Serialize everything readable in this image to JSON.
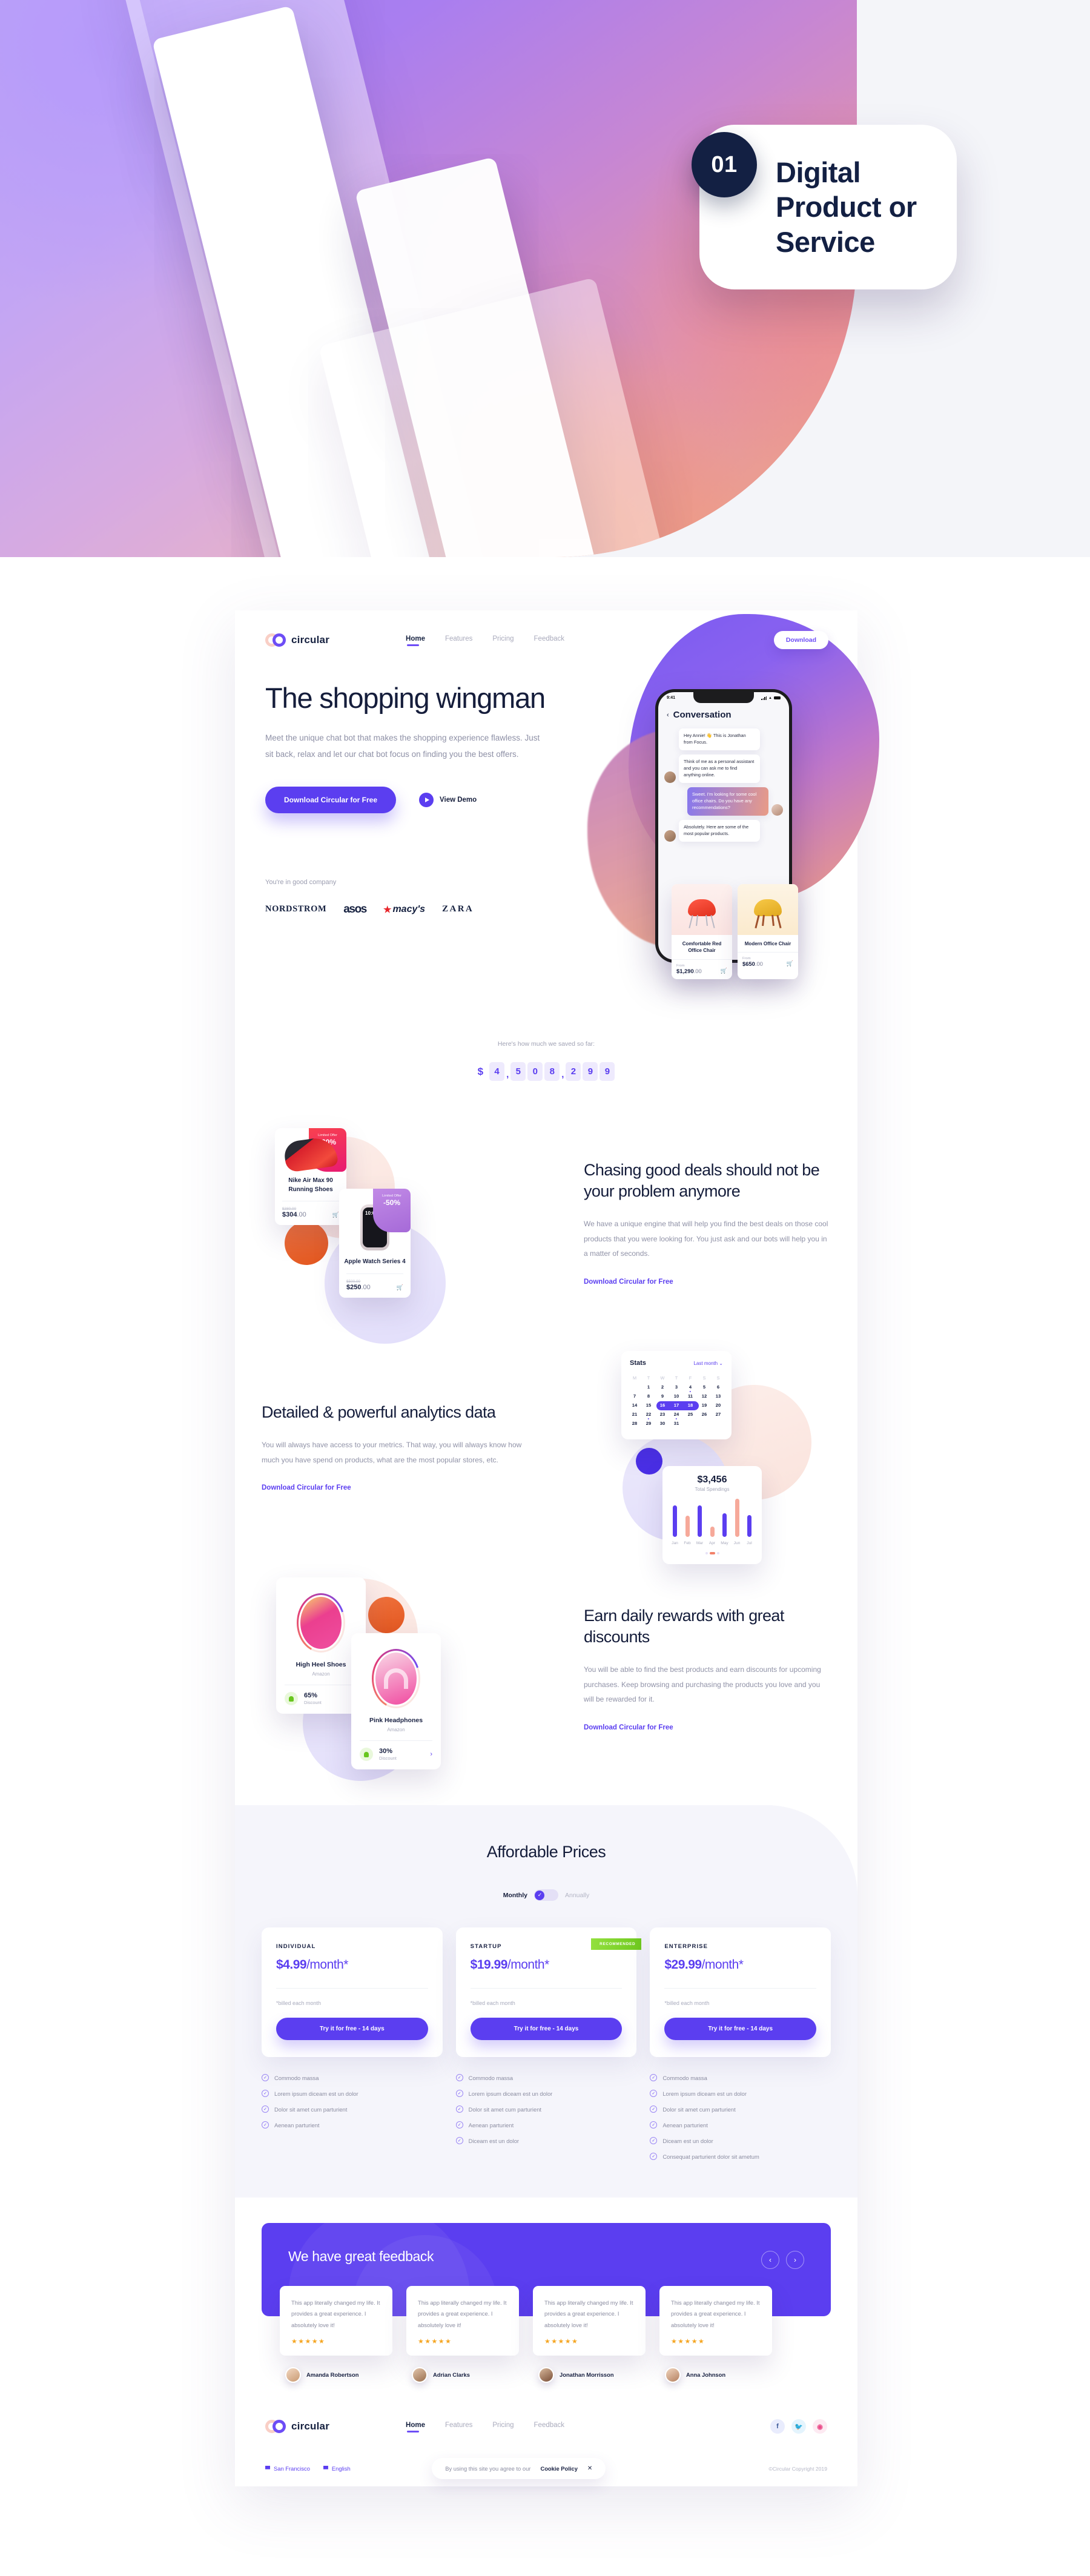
{
  "presentation": {
    "badge_number": "01",
    "badge_title": "Digital Product or Service"
  },
  "nav": {
    "brand": "circular",
    "links": [
      {
        "label": "Home",
        "active": true
      },
      {
        "label": "Features",
        "active": false
      },
      {
        "label": "Pricing",
        "active": false
      },
      {
        "label": "Feedback",
        "active": false
      }
    ],
    "download_label": "Download"
  },
  "hero": {
    "title": "The shopping wingman",
    "subtitle": "Meet the unique chat bot that makes the shopping experience flawless. Just sit back, relax and let our chat bot focus on finding you the best offers.",
    "primary_cta": "Download Circular for Free",
    "demo_label": "View Demo",
    "company_note": "You're in good company",
    "brands": [
      "NORDSTROM",
      "asos",
      "macy's",
      "ZARA"
    ],
    "phone": {
      "time": "9:41",
      "screen_title": "Conversation",
      "messages": [
        {
          "from": "them",
          "text": "Hey Annie! 👋 This is Jonathan from Focus."
        },
        {
          "from": "them",
          "text": "Think of me as a personal assistant and you can ask me to find anything online."
        },
        {
          "from": "me",
          "text": "Sweet. I'm looking for some cool office chairs. Do you have any recommendations?"
        },
        {
          "from": "them",
          "text": "Absolutely. Here are some of the most popular products."
        }
      ]
    },
    "products": [
      {
        "name": "Comfortable Red Office Chair",
        "from_label": "From",
        "price": "$1,290",
        "cents": ".00"
      },
      {
        "name": "Modern Office Chair",
        "from_label": "From",
        "price": "$650",
        "cents": ".00"
      }
    ]
  },
  "counter": {
    "note": "Here's how much we saved so far:",
    "currency": "$",
    "digits": [
      "4",
      "5",
      "0",
      "8",
      "2",
      "9",
      "9"
    ],
    "separator": ","
  },
  "features": [
    {
      "title": "Chasing good deals should not be your problem anymore",
      "body": "We have a unique engine that will help you find the best deals on those cool products that you were looking for. You just ask and our bots will help you in a matter of seconds.",
      "link": "Download Circular for Free",
      "cards": [
        {
          "tag_label": "Limited Offer",
          "tag_value": "-20%",
          "name": "Nike Air Max 90 Running Shoes",
          "old": "$380.00",
          "price": "$304",
          "cents": ".00"
        },
        {
          "tag_label": "Limited Offer",
          "tag_value": "-50%",
          "name": "Apple Watch Series 4",
          "old": "$500.00",
          "price": "$250",
          "cents": ".00"
        }
      ]
    },
    {
      "title": "Detailed & powerful analytics data",
      "body": "You will always have access to your metrics. That way, you will always know how much you have spend on products, what are the most popular stores, etc.",
      "link": "Download Circular for Free"
    },
    {
      "title": "Earn daily rewards with great discounts",
      "body": "You will be able to find the best products and earn discounts for upcoming purchases. Keep browsing and purchasing the products you love and you will be rewarded for it.",
      "link": "Download Circular for Free",
      "cards": [
        {
          "name": "High Heel Shoes",
          "store": "Amazon",
          "pct": "65%",
          "label": "Discount"
        },
        {
          "name": "Pink Headphones",
          "store": "Amazon",
          "pct": "30%",
          "label": "Discount"
        }
      ]
    }
  ],
  "stats_card": {
    "title": "Stats",
    "range": "Last month",
    "weekdays": [
      "M",
      "T",
      "W",
      "T",
      "F",
      "S",
      "S"
    ],
    "weeks": [
      [
        "",
        "1",
        "2",
        "3",
        "4",
        "5",
        "6"
      ],
      [
        "7",
        "8",
        "9",
        "10",
        "11",
        "12",
        "13"
      ],
      [
        "14",
        "15",
        "16",
        "17",
        "18",
        "19",
        "20"
      ],
      [
        "21",
        "22",
        "23",
        "24",
        "25",
        "26",
        "27"
      ],
      [
        "28",
        "29",
        "30",
        "31",
        "",
        "",
        ""
      ]
    ],
    "dotted": [
      "4",
      "22",
      "24"
    ],
    "selected": [
      "16",
      "17",
      "18"
    ]
  },
  "chart_data": {
    "type": "bar",
    "title": "$3,456",
    "subtitle": "Total Spendings",
    "categories": [
      "Jan",
      "Feb",
      "Mar",
      "Apr",
      "May",
      "Jun",
      "Jul"
    ],
    "values": [
      72,
      48,
      72,
      24,
      54,
      88,
      50
    ],
    "colors": [
      "#5b3ef0",
      "#f6a99a",
      "#5b3ef0",
      "#f6a99a",
      "#5b3ef0",
      "#f6a99a",
      "#5b3ef0"
    ],
    "ylim": [
      0,
      100
    ],
    "xlabel": "",
    "ylabel": "",
    "grid": false,
    "legend": "none"
  },
  "pricing": {
    "title": "Affordable Prices",
    "toggle": {
      "left": "Monthly",
      "right": "Annually",
      "selected": "Monthly"
    },
    "ribbon": "RECOMMENDED",
    "plans": [
      {
        "name": "INDIVIDUAL",
        "price": "$4.99",
        "per": "/month*",
        "note": "*billed each month",
        "cta": "Try it for free - 14 days",
        "recommended": false,
        "features": [
          "Commodo massa",
          "Lorem ipsum diceam est un dolor",
          "Dolor sit amet cum parturient",
          "Aenean parturient"
        ]
      },
      {
        "name": "STARTUP",
        "price": "$19.99",
        "per": "/month*",
        "note": "*billed each month",
        "cta": "Try it for free - 14 days",
        "recommended": true,
        "features": [
          "Commodo massa",
          "Lorem ipsum diceam est un dolor",
          "Dolor sit amet cum parturient",
          "Aenean parturient",
          "Diceam est un dolor"
        ]
      },
      {
        "name": "ENTERPRISE",
        "price": "$29.99",
        "per": "/month*",
        "note": "*billed each month",
        "cta": "Try it for free - 14 days",
        "recommended": false,
        "features": [
          "Commodo massa",
          "Lorem ipsum diceam est un dolor",
          "Dolor sit amet cum parturient",
          "Aenean parturient",
          "Diceam est un dolor",
          "Consequat parturient dolor sit ametum"
        ]
      }
    ]
  },
  "feedback": {
    "title": "We have great feedback",
    "prev": "‹",
    "next": "›",
    "testimonials": [
      {
        "text": "This app literally changed my life. It provides a great experience. I absolutely love it!",
        "stars": "★★★★★",
        "name": "Amanda Robertson"
      },
      {
        "text": "This app literally changed my life. It provides a great experience. I absolutely love it!",
        "stars": "★★★★★",
        "name": "Adrian Clarks"
      },
      {
        "text": "This app literally changed my life. It provides a great experience. I absolutely love it!",
        "stars": "★★★★★",
        "name": "Jonathan Morrisson"
      },
      {
        "text": "This app literally changed my life. It provides a great experience. I absolutely love it!",
        "stars": "★★★★★",
        "name": "Anna Johnson"
      }
    ]
  },
  "footer": {
    "brand": "circular",
    "links": [
      {
        "label": "Home",
        "active": true
      },
      {
        "label": "Features",
        "active": false
      },
      {
        "label": "Pricing",
        "active": false
      },
      {
        "label": "Feedback",
        "active": false
      }
    ],
    "social": [
      "f",
      "t",
      "d"
    ],
    "location": "San Francisco",
    "language": "English",
    "cookie_text": "By using this site you agree to our",
    "cookie_link": "Cookie Policy",
    "cookie_close": "✕",
    "copyright": "©Circular Copyright 2019"
  },
  "colors": {
    "accent": "#5b3ef0",
    "dark": "#151d3b",
    "muted": "#8e90a6",
    "peach": "#f6a99a",
    "green": "#6fc91f"
  }
}
